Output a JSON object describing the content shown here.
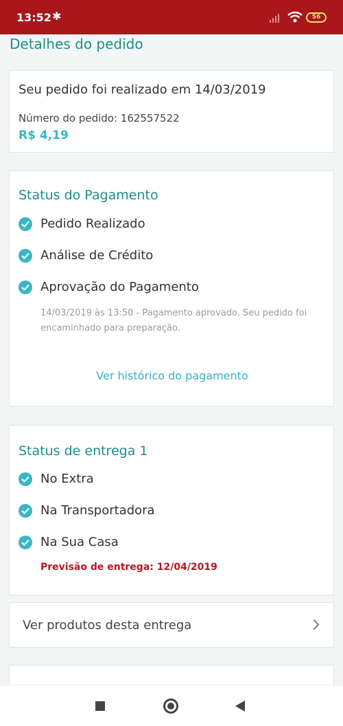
{
  "status_bar": {
    "time": "13:52",
    "battery": "56"
  },
  "page": {
    "title": "Detalhes do pedido"
  },
  "order": {
    "placed_text": "Seu pedido foi realizado em 14/03/2019",
    "number_text": "Número do pedido: 162557522",
    "price": "R$ 4,19"
  },
  "payment": {
    "title": "Status do Pagamento",
    "steps": [
      {
        "label": "Pedido Realizado"
      },
      {
        "label": "Análise de Crédito"
      },
      {
        "label": "Aprovação do Pagamento"
      }
    ],
    "note": "14/03/2019 às 13:50 - Pagamento aprovado. Seu pedido foi encaminhado para preparação.",
    "history_link": "Ver histórico do pagamento"
  },
  "delivery": {
    "title": "Status de entrega 1",
    "steps": [
      {
        "label": "No Extra"
      },
      {
        "label": "Na Transportadora"
      },
      {
        "label": "Na Sua Casa"
      }
    ],
    "eta": "Previsão de entrega: 12/04/2019"
  },
  "products_link": {
    "label": "Ver produtos desta entrega"
  },
  "colors": {
    "status_bar": "#a9161c",
    "accent_teal": "#1b8e8c",
    "check": "#38b7c6",
    "price": "#35b8c4",
    "eta_red": "#b8161c"
  },
  "icons": {
    "status_steps": "check-circle-icon",
    "products_link": "chevron-right-icon"
  }
}
